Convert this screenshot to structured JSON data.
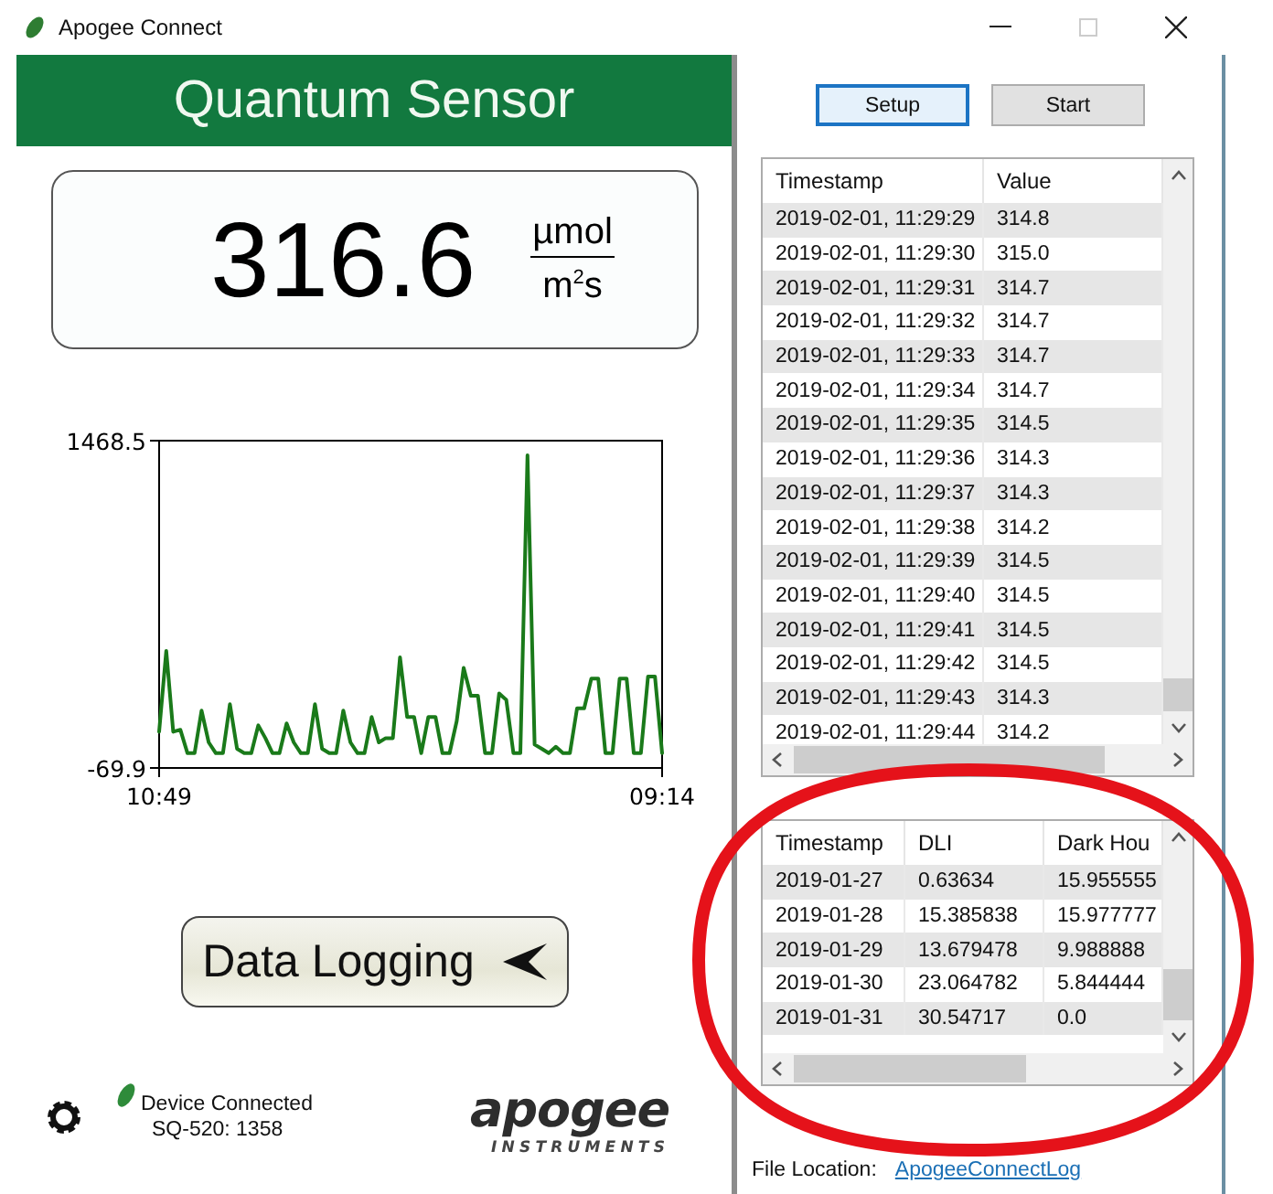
{
  "window": {
    "title": "Apogee Connect"
  },
  "header": {
    "title": "Quantum Sensor"
  },
  "reading": {
    "value": "316.6",
    "unit_top": "µmol",
    "unit_bottom": "m$^{2}$s"
  },
  "chart_data": {
    "type": "line",
    "categories": [
      "10:49",
      null,
      null,
      null,
      null,
      null,
      null,
      null,
      null,
      null,
      null,
      null,
      null,
      null,
      null,
      null,
      null,
      null,
      null,
      null,
      null,
      null,
      null,
      null,
      null,
      null,
      null,
      null,
      null,
      null,
      null,
      null,
      null,
      null,
      null,
      null,
      null,
      null,
      null,
      null,
      null,
      null,
      null,
      null,
      null,
      null,
      null,
      null,
      null,
      null,
      null,
      null,
      null,
      null,
      null,
      null,
      null,
      null,
      null,
      null,
      null,
      null,
      null,
      null,
      null,
      null,
      null,
      null,
      null,
      null,
      null,
      "09:14"
    ],
    "series": [
      {
        "color": "#1a7a1a",
        "values": [
          100,
          480,
          100,
          110,
          0,
          0,
          200,
          50,
          0,
          0,
          230,
          20,
          0,
          0,
          130,
          70,
          0,
          0,
          140,
          50,
          0,
          0,
          230,
          20,
          0,
          0,
          200,
          50,
          0,
          0,
          170,
          50,
          70,
          70,
          450,
          170,
          170,
          0,
          170,
          170,
          0,
          0,
          150,
          400,
          270,
          270,
          0,
          0,
          280,
          250,
          0,
          0,
          1400,
          40,
          20,
          0,
          30,
          0,
          0,
          210,
          210,
          350,
          350,
          0,
          0,
          350,
          350,
          0,
          0,
          360,
          360,
          0
        ]
      }
    ],
    "ylim": [
      -69.9,
      1468.5
    ],
    "yticks": [
      -69.9,
      1468.5
    ]
  },
  "data_logging_button": {
    "label": "Data Logging"
  },
  "status": {
    "line1": "Device Connected",
    "line2": "SQ-520: 1358"
  },
  "logo": {
    "name": "apogee",
    "subtitle": "INSTRUMENTS"
  },
  "buttons": [
    {
      "label": "Setup",
      "focused": true
    },
    {
      "label": "Start",
      "focused": false
    }
  ],
  "log_table": {
    "columns": [
      "Timestamp",
      "Value"
    ],
    "rows": [
      [
        "2019-02-01, 11:29:29",
        "314.8"
      ],
      [
        "2019-02-01, 11:29:30",
        "315.0"
      ],
      [
        "2019-02-01, 11:29:31",
        "314.7"
      ],
      [
        "2019-02-01, 11:29:32",
        "314.7"
      ],
      [
        "2019-02-01, 11:29:33",
        "314.7"
      ],
      [
        "2019-02-01, 11:29:34",
        "314.7"
      ],
      [
        "2019-02-01, 11:29:35",
        "314.5"
      ],
      [
        "2019-02-01, 11:29:36",
        "314.3"
      ],
      [
        "2019-02-01, 11:29:37",
        "314.3"
      ],
      [
        "2019-02-01, 11:29:38",
        "314.2"
      ],
      [
        "2019-02-01, 11:29:39",
        "314.5"
      ],
      [
        "2019-02-01, 11:29:40",
        "314.5"
      ],
      [
        "2019-02-01, 11:29:41",
        "314.5"
      ],
      [
        "2019-02-01, 11:29:42",
        "314.5"
      ],
      [
        "2019-02-01, 11:29:43",
        "314.3"
      ],
      [
        "2019-02-01, 11:29:44",
        "314.2"
      ]
    ]
  },
  "daily_table": {
    "columns": [
      "Timestamp",
      "DLI",
      "Dark Hou"
    ],
    "rows": [
      [
        "2019-01-27",
        "0.63634",
        "15.955555"
      ],
      [
        "2019-01-28",
        "15.385838",
        "15.977777"
      ],
      [
        "2019-01-29",
        "13.679478",
        "9.988888"
      ],
      [
        "2019-01-30",
        "23.064782",
        "5.844444"
      ],
      [
        "2019-01-31",
        "30.54717",
        "0.0"
      ]
    ]
  },
  "file_location": {
    "label": "File Location:",
    "link": "ApogeeConnectLog"
  }
}
